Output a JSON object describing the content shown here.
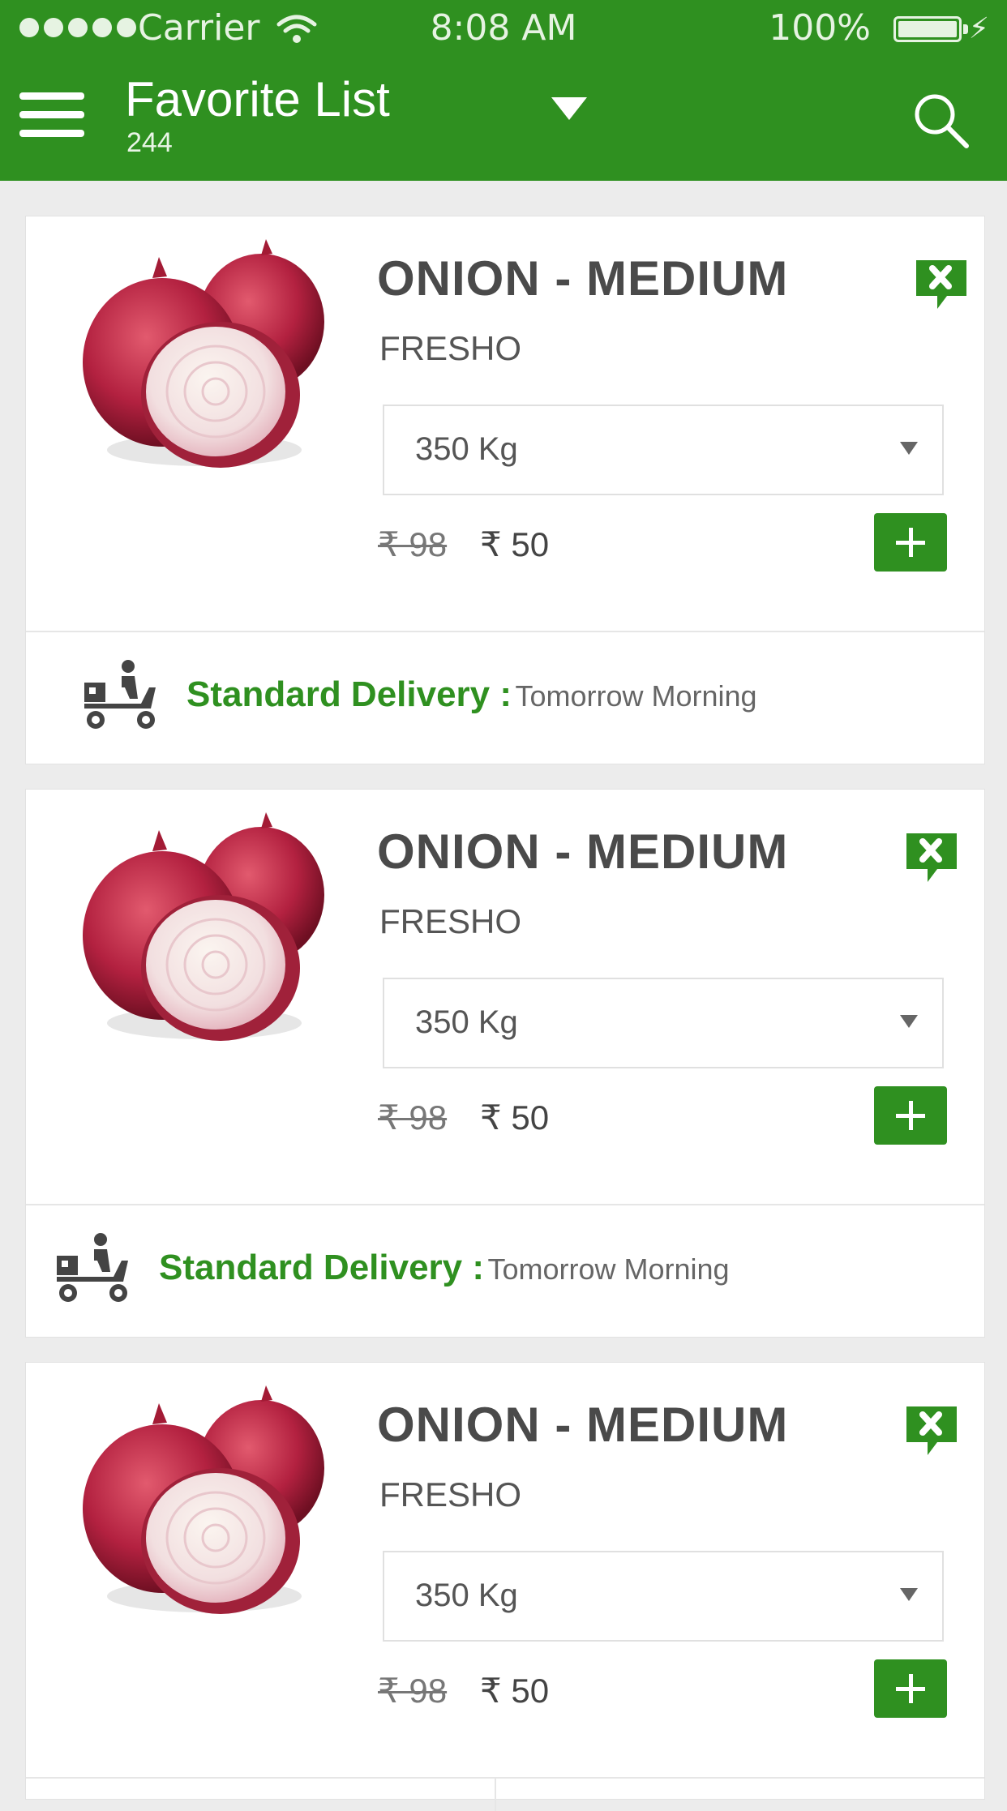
{
  "status_bar": {
    "carrier": "Carrier",
    "time": "8:08 AM",
    "battery": "100%"
  },
  "nav": {
    "title": "Favorite List",
    "count": "244"
  },
  "products": [
    {
      "name": "ONION - MEDIUM",
      "brand": "FRESHO",
      "quantity": "350 Kg",
      "mrp": "₹ 98",
      "price": "₹ 50",
      "delivery_label": "Standard Delivery :",
      "delivery_time": "Tomorrow Morning"
    },
    {
      "name": "ONION - MEDIUM",
      "brand": "FRESHO",
      "quantity": "350 Kg",
      "mrp": "₹ 98",
      "price": "₹ 50",
      "delivery_label": "Standard Delivery :",
      "delivery_time": "Tomorrow Morning"
    },
    {
      "name": "ONION - MEDIUM",
      "brand": "FRESHO",
      "quantity": "350 Kg",
      "mrp": "₹ 98",
      "price": "₹ 50"
    }
  ],
  "colors": {
    "brand_green": "#2f9020",
    "background": "#ececec"
  }
}
